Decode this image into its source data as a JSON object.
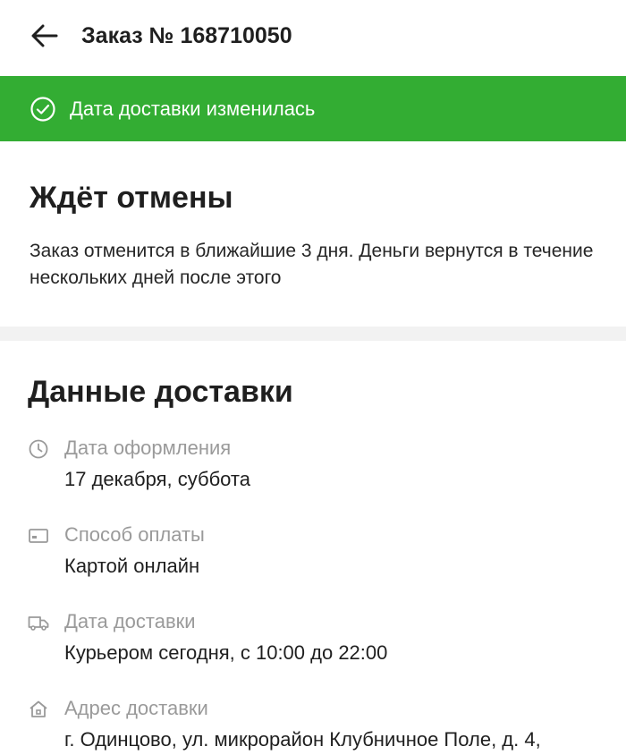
{
  "header": {
    "title": "Заказ № 168710050",
    "back_icon": "arrow-left-icon"
  },
  "banner": {
    "text": "Дата доставки изменилась",
    "icon": "check-circle-icon",
    "color": "#33ad33"
  },
  "status": {
    "title": "Ждёт отмены",
    "description": "Заказ отменится в ближайшие 3 дня. Деньги вернутся в течение нескольких дней после этого"
  },
  "delivery": {
    "title": "Данные доставки",
    "rows": [
      {
        "icon": "clock-icon",
        "label": "Дата оформления",
        "value": "17 декабря, суббота"
      },
      {
        "icon": "card-icon",
        "label": "Способ оплаты",
        "value": "Картой онлайн"
      },
      {
        "icon": "truck-icon",
        "label": "Дата доставки",
        "value": "Курьером сегодня, с 10:00 до 22:00"
      },
      {
        "icon": "home-icon",
        "label": "Адрес доставки",
        "value": "г. Одинцово, ул. микрорайон Клубничное Поле, д. 4,"
      }
    ]
  }
}
